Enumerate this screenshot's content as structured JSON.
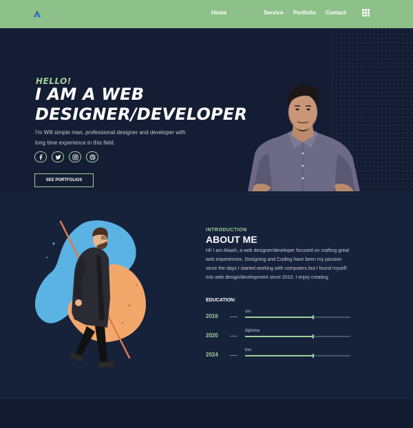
{
  "nav": {
    "logo_icon": "triangle-logo-icon",
    "links": [
      "Home",
      "Service",
      "Portfolio",
      "Contact"
    ],
    "menu_icon": "grid-menu-icon"
  },
  "hero": {
    "greeting": "HELLO!",
    "headline_line1": "I AM A WEB",
    "headline_line2": "DESIGNER/DEVELOPER",
    "intro": "I'm Will simple man, professional designer and developer with long time experience in this field.",
    "socials": [
      "facebook-icon",
      "twitter-icon",
      "instagram-icon",
      "dribbble-icon"
    ],
    "cta_label": "SEE PORTFOLIOS",
    "accent": "#9fd19b"
  },
  "about": {
    "tag": "INTRODUCTION",
    "title": "ABOUT ME",
    "text": "Hi! I am Akash, a web designer/developer focused on crafting great web experiences. Designing and Coding have been my passion since the days I started working with computers but I found myself into web design/development since 2010. I enjoy creating",
    "education_title": "EDUCATION:",
    "education": [
      {
        "year": "2016",
        "label": "ssc",
        "progress": 0.64
      },
      {
        "year": "2020",
        "label": "diploma",
        "progress": 0.64
      },
      {
        "year": "2024",
        "label": "bsc",
        "progress": 0.64
      }
    ]
  },
  "colors": {
    "nav_bg": "#8dc189",
    "page_bg": "#16213a",
    "hero_bg": "#141d33",
    "accent": "#9fd19b"
  }
}
